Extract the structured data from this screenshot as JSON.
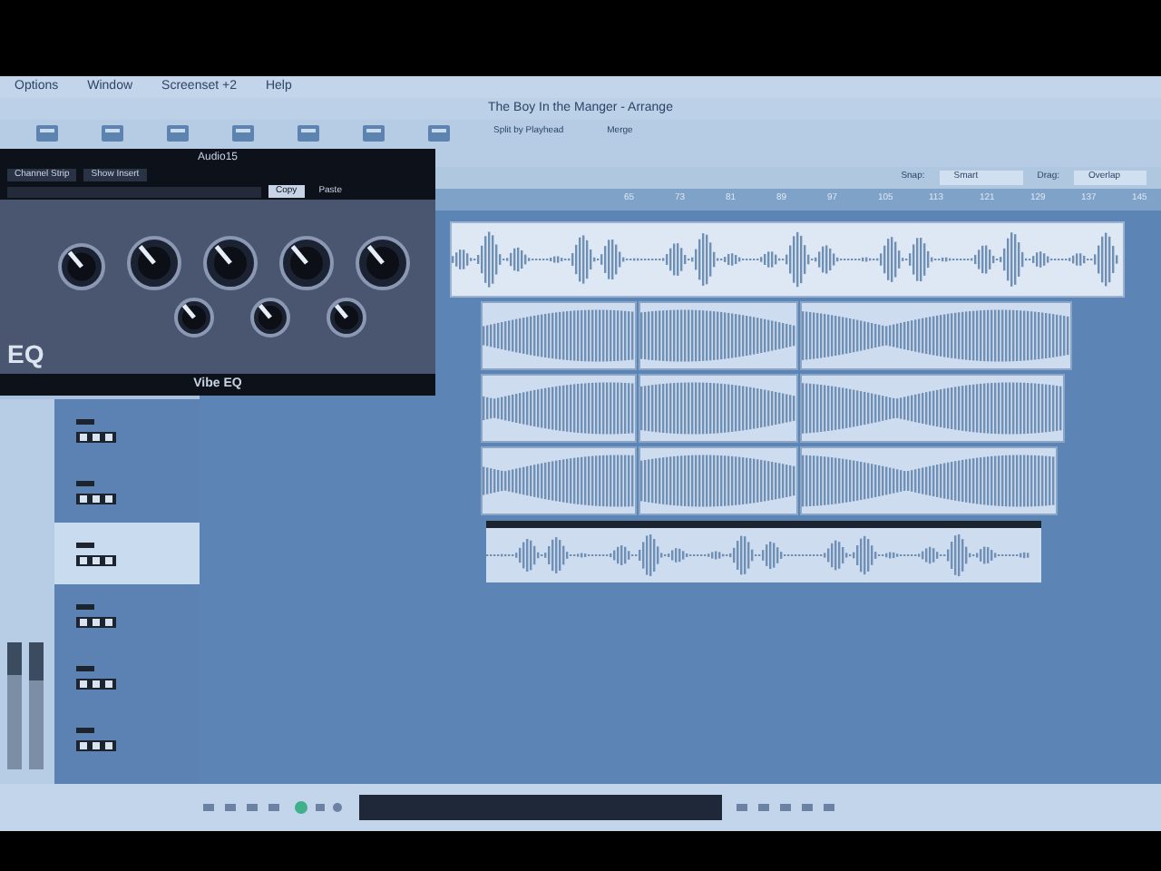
{
  "menu": [
    {
      "label": "Options"
    },
    {
      "label": "Window"
    },
    {
      "label": "Screenset +2"
    },
    {
      "label": "Help"
    }
  ],
  "window": {
    "title": "The Boy In the Manger - Arrange"
  },
  "toolbar": [
    {
      "label": "Split by Playhead"
    },
    {
      "label": "Merge"
    }
  ],
  "snap": {
    "label": "Snap:",
    "value": "Smart"
  },
  "drag": {
    "label": "Drag:",
    "value": "Overlap"
  },
  "ruler": [
    "65",
    "73",
    "81",
    "89",
    "97",
    "105",
    "113",
    "121",
    "129",
    "137",
    "145"
  ],
  "plugin": {
    "title": "Audio15",
    "channel_strip": "Channel Strip",
    "show_insert": "Show Insert",
    "copy": "Copy",
    "paste": "Paste",
    "name": "Vibe EQ",
    "logo": "EQ"
  },
  "tracks": [
    {
      "selected": false
    },
    {
      "selected": false
    },
    {
      "selected": true
    },
    {
      "selected": false
    },
    {
      "selected": false
    },
    {
      "selected": false
    }
  ],
  "faders": [
    {
      "level": 0.75
    },
    {
      "level": 0.7
    }
  ]
}
